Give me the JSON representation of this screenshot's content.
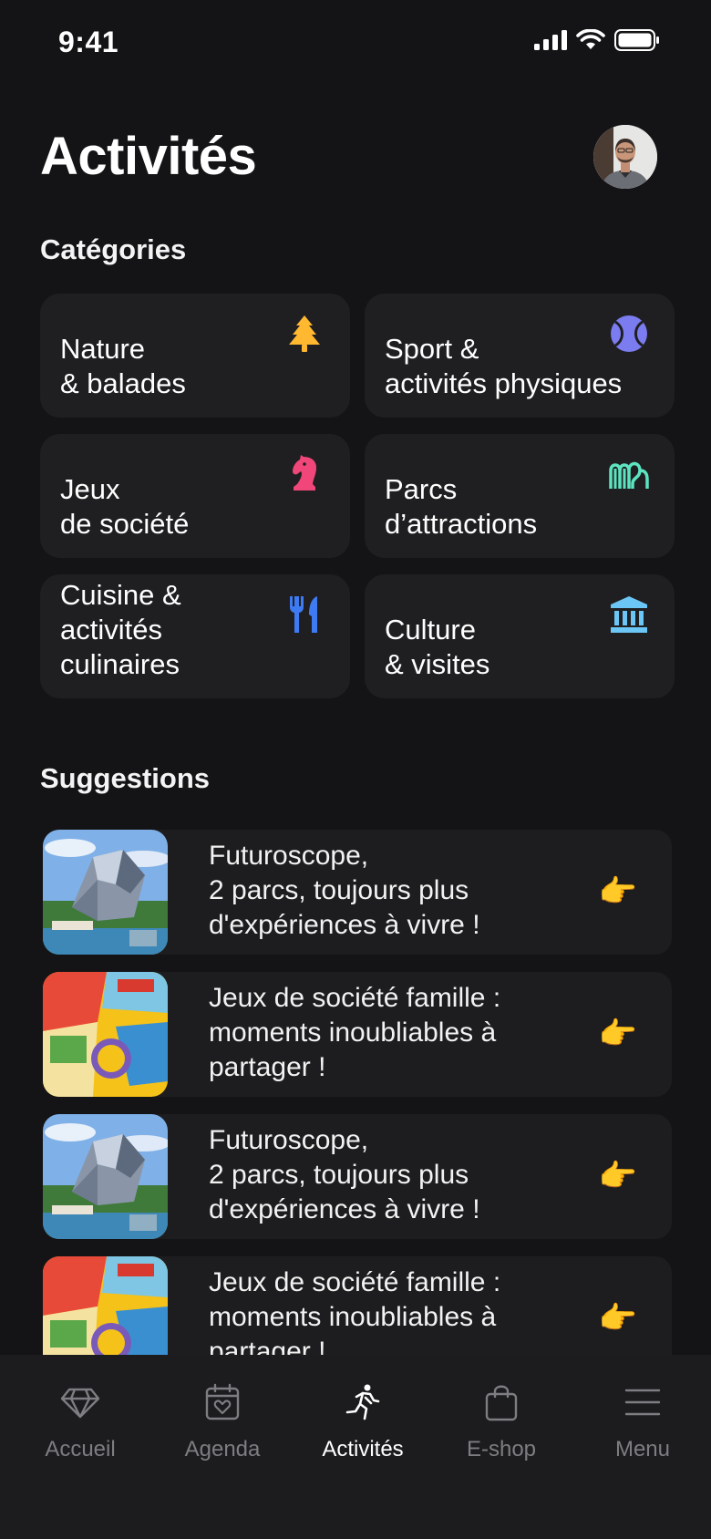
{
  "status": {
    "time": "9:41"
  },
  "header": {
    "title": "Activités"
  },
  "categories": {
    "title": "Catégories",
    "items": [
      {
        "label": "Nature\n& balades",
        "icon": "tree-icon",
        "color": "#FFB830"
      },
      {
        "label": "Sport &\nactivités physiques",
        "icon": "tennis-ball-icon",
        "color": "#7B7CF0"
      },
      {
        "label": "Jeux\nde société",
        "icon": "chess-knight-icon",
        "color": "#F0467A"
      },
      {
        "label": "Parcs\nd’attractions",
        "icon": "roller-coaster-icon",
        "color": "#5DE3C0"
      },
      {
        "label": "Cuisine &\nactivités\nculinaires",
        "icon": "fork-knife-icon",
        "color": "#3E7BF2"
      },
      {
        "label": "Culture\n& visites",
        "icon": "museum-icon",
        "color": "#6BC5F5"
      }
    ]
  },
  "suggestions": {
    "title": "Suggestions",
    "items": [
      {
        "text": "Futuroscope,\n2 parcs, toujours plus\nd'expériences à vivre !",
        "thumb": "futuroscope",
        "arrow": "👉"
      },
      {
        "text": "Jeux de société famille :\nmoments inoubliables à\npartager !",
        "thumb": "board-games",
        "arrow": "👉"
      },
      {
        "text": "Futuroscope,\n2 parcs, toujours plus\nd'expériences à vivre !",
        "thumb": "futuroscope",
        "arrow": "👉"
      },
      {
        "text": "Jeux de société famille :\nmoments inoubliables à\npartager !",
        "thumb": "board-games",
        "arrow": "👉"
      }
    ]
  },
  "tabs": [
    {
      "label": "Accueil",
      "icon": "diamond-icon",
      "active": false
    },
    {
      "label": "Agenda",
      "icon": "calendar-heart-icon",
      "active": false
    },
    {
      "label": "Activités",
      "icon": "running-icon",
      "active": true
    },
    {
      "label": "E-shop",
      "icon": "shopping-bag-icon",
      "active": false
    },
    {
      "label": "Menu",
      "icon": "hamburger-menu-icon",
      "active": false
    }
  ]
}
